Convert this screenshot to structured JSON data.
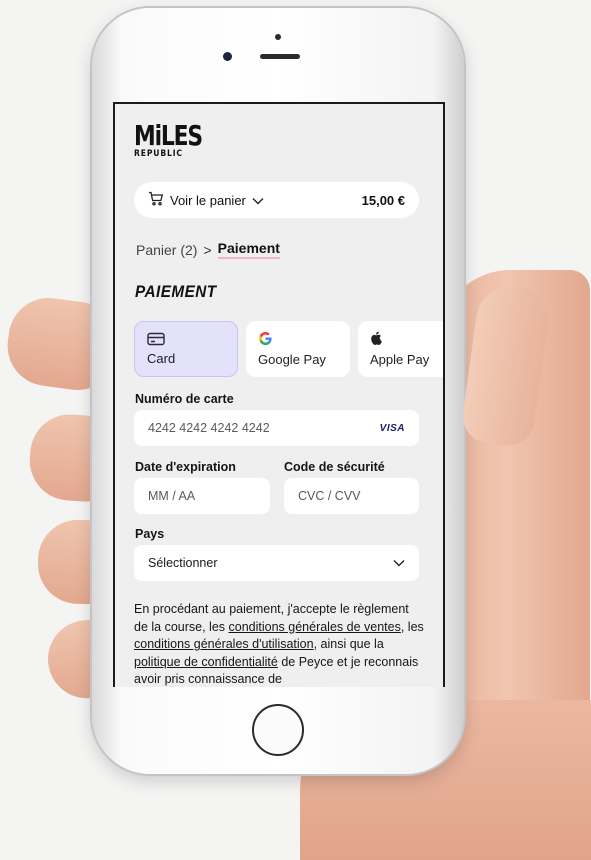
{
  "brand": {
    "logo_main": "MiLES",
    "logo_sub": "REPUBLIC"
  },
  "cart": {
    "label": "Voir le panier",
    "total": "15,00 €",
    "icons": {
      "cart": "cart-icon",
      "chevron": "chevron-down-icon"
    }
  },
  "breadcrumb": {
    "previous": "Panier (2)",
    "separator": ">",
    "current": "Paiement"
  },
  "page": {
    "heading": "PAIEMENT"
  },
  "payment_methods": [
    {
      "label": "Card",
      "icon": "credit-card-icon",
      "active": true
    },
    {
      "label": "Google Pay",
      "icon": "google-icon",
      "active": false
    },
    {
      "label": "Apple Pay",
      "icon": "apple-icon",
      "active": false
    }
  ],
  "form": {
    "card_number": {
      "label": "Numéro de carte",
      "value": "4242 4242 4242 4242",
      "brand": "VISA"
    },
    "expiry": {
      "label": "Date d'expiration",
      "placeholder": "MM / AA"
    },
    "cvc": {
      "label": "Code de sécurité",
      "placeholder": "CVC / CVV"
    },
    "country": {
      "label": "Pays",
      "value": "Sélectionner"
    }
  },
  "legal": {
    "part1": "En procédant au paiement, j'accepte le règlement de la course, les ",
    "link_cgv": "conditions générales de ventes",
    "part2": ", les ",
    "link_cgu": "conditions générales d'utilisation",
    "part3": ", ainsi que la ",
    "link_privacy": "politique de confidentialité",
    "part4": " de Peyce et je reconnais avoir pris connaissance de"
  },
  "colors": {
    "accent_active": "#e4e1fb",
    "breadcrumb_underline": "#f3b6c7",
    "screen_bg": "#efefef"
  }
}
